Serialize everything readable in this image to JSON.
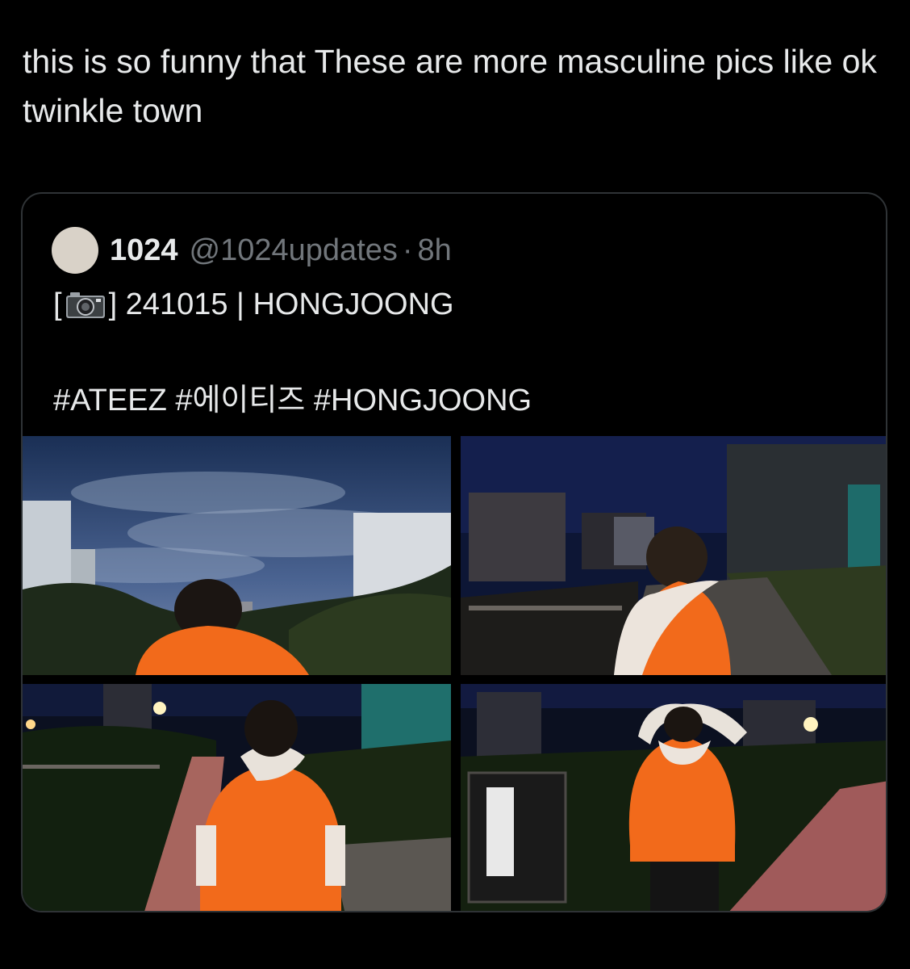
{
  "post": {
    "text": "this is so funny that These are more masculine pics like ok twinkle town"
  },
  "quote": {
    "name": "1024",
    "handle": "@1024updates",
    "separator": "·",
    "time": "8h",
    "line1_open": "[",
    "line1_close": "] 241015 | HONGJOONG",
    "line2": "#ATEEZ #에이티즈 #HONGJOONG",
    "icons": [
      "camera-icon"
    ],
    "photos": [
      {
        "name": "photo-night-sky-back"
      },
      {
        "name": "photo-fence-scarf-pose"
      },
      {
        "name": "photo-walkway-back"
      },
      {
        "name": "photo-arms-raised-back"
      }
    ]
  },
  "colors": {
    "background": "#000000",
    "text": "#e7e9ea",
    "muted": "#71767b",
    "border": "#2f3336",
    "accent_shirt": "#f26a1b"
  }
}
